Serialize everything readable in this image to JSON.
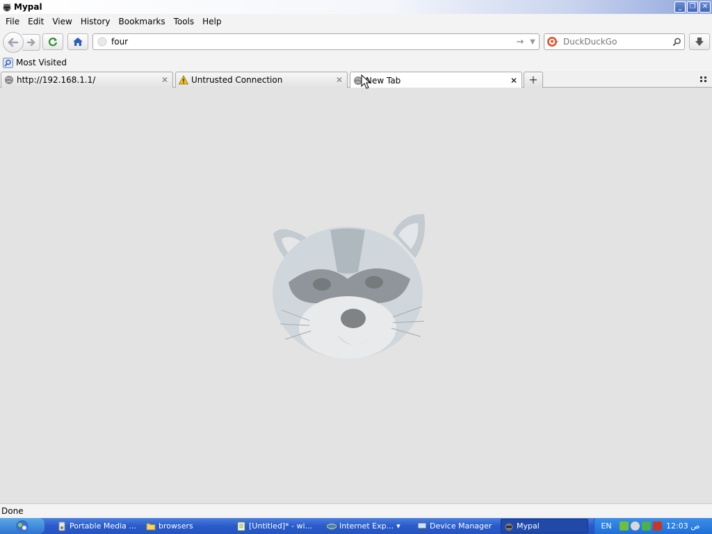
{
  "window": {
    "title": "Mypal"
  },
  "menu": {
    "items": [
      {
        "label": "File"
      },
      {
        "label": "Edit"
      },
      {
        "label": "View"
      },
      {
        "label": "History"
      },
      {
        "label": "Bookmarks"
      },
      {
        "label": "Tools"
      },
      {
        "label": "Help"
      }
    ]
  },
  "nav": {
    "url_value": "four",
    "search_placeholder": "DuckDuckGo"
  },
  "bookmarks": {
    "items": [
      {
        "label": "Most Visited"
      }
    ]
  },
  "tabs": [
    {
      "label": "http://192.168.1.1/",
      "icon": "globe-icon",
      "selected": false
    },
    {
      "label": "Untrusted Connection",
      "icon": "warning-icon",
      "selected": false
    },
    {
      "label": "New Tab",
      "icon": "globe-icon",
      "selected": true
    }
  ],
  "status": {
    "text": "Done"
  },
  "taskbar": {
    "tasks": [
      {
        "label": "Portable Media ...",
        "icon": "media-icon"
      },
      {
        "label": "browsers",
        "icon": "folder-icon"
      },
      {
        "label": "[Untitled]* - wi...",
        "icon": "notepad-icon"
      },
      {
        "label": "Internet Exp...",
        "icon": "ie-icon"
      },
      {
        "label": "Device Manager",
        "icon": "device-manager-icon"
      },
      {
        "label": "Mypal",
        "icon": "mypal-icon",
        "active": true
      }
    ],
    "language": "EN",
    "clock": "12:03 ص"
  },
  "colors": {
    "taskbar": "#2a5bc9",
    "content_bg": "#e3e3e3",
    "chrome_bg": "#f3f3f3"
  }
}
